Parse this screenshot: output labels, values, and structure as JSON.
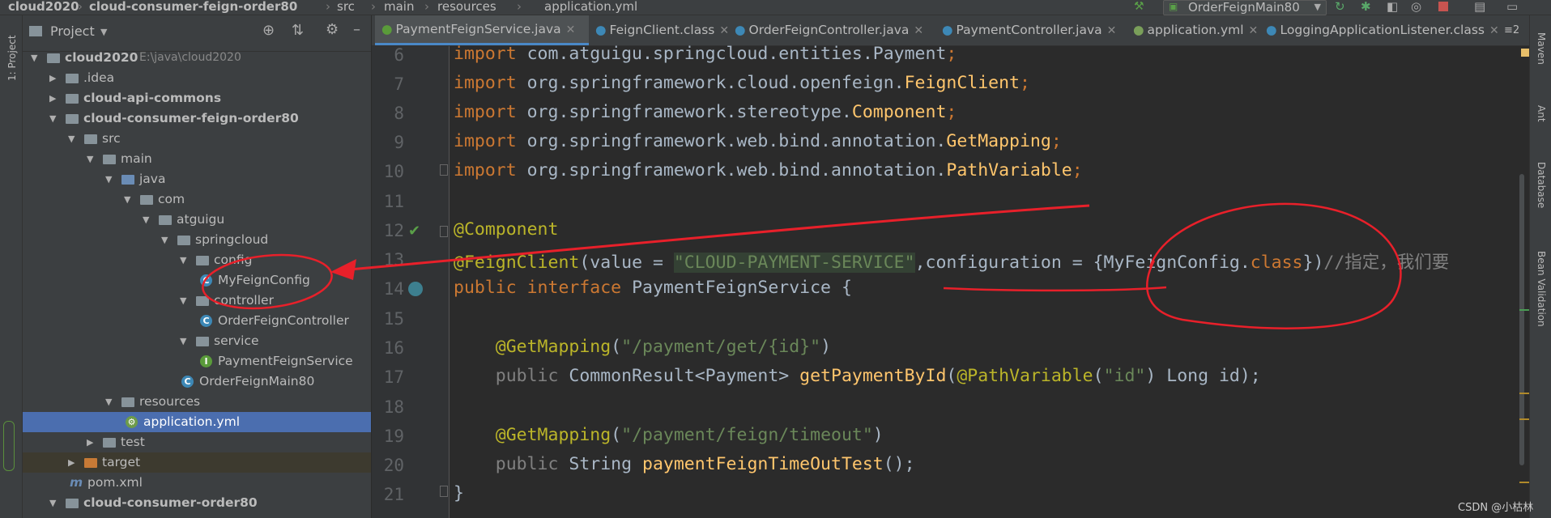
{
  "breadcrumb": [
    "cloud2020",
    "cloud-consumer-feign-order80",
    "src",
    "main",
    "resources",
    "application.yml"
  ],
  "run_config": "OrderFeignMain80",
  "left_strip_label": "1: Project",
  "right_strip_labels": [
    "Maven",
    "Ant",
    "Database",
    "Bean Validation"
  ],
  "project_panel": {
    "title": "Project",
    "tree": [
      {
        "depth": 0,
        "label": "cloud2020",
        "suffix": "E:\\java\\cloud2020",
        "icon": "folder",
        "open": true,
        "bold": true
      },
      {
        "depth": 1,
        "label": ".idea",
        "icon": "folder",
        "open": false
      },
      {
        "depth": 1,
        "label": "cloud-api-commons",
        "icon": "module",
        "open": false,
        "bold": true
      },
      {
        "depth": 1,
        "label": "cloud-consumer-feign-order80",
        "icon": "module",
        "open": true,
        "bold": true
      },
      {
        "depth": 2,
        "label": "src",
        "icon": "folder",
        "open": true
      },
      {
        "depth": 3,
        "label": "main",
        "icon": "folder",
        "open": true
      },
      {
        "depth": 4,
        "label": "java",
        "icon": "folder-blue",
        "open": true
      },
      {
        "depth": 5,
        "label": "com",
        "icon": "package",
        "open": true
      },
      {
        "depth": 6,
        "label": "atguigu",
        "icon": "package",
        "open": true
      },
      {
        "depth": 7,
        "label": "springcloud",
        "icon": "package",
        "open": true
      },
      {
        "depth": 8,
        "label": "config",
        "icon": "package",
        "open": true
      },
      {
        "depth": 9,
        "label": "MyFeignConfig",
        "icon": "class"
      },
      {
        "depth": 8,
        "label": "controller",
        "icon": "package",
        "open": true
      },
      {
        "depth": 9,
        "label": "OrderFeignController",
        "icon": "class"
      },
      {
        "depth": 8,
        "label": "service",
        "icon": "package",
        "open": true
      },
      {
        "depth": 9,
        "label": "PaymentFeignService",
        "icon": "interface"
      },
      {
        "depth": 8,
        "label": "OrderFeignMain80",
        "icon": "class-run"
      },
      {
        "depth": 4,
        "label": "resources",
        "icon": "folder-res",
        "open": true
      },
      {
        "depth": 5,
        "label": "application.yml",
        "icon": "yml",
        "selected": true
      },
      {
        "depth": 3,
        "label": "test",
        "icon": "folder",
        "open": false
      },
      {
        "depth": 2,
        "label": "target",
        "icon": "folder-orange",
        "open": false
      },
      {
        "depth": 2,
        "label": "pom.xml",
        "icon": "maven"
      },
      {
        "depth": 1,
        "label": "cloud-consumer-order80",
        "icon": "module",
        "open": true,
        "bold": true
      }
    ]
  },
  "tabs": [
    {
      "label": "PaymentFeignService.java",
      "active": true
    },
    {
      "label": "FeignClient.class"
    },
    {
      "label": "OrderFeignController.java"
    },
    {
      "label": "PaymentController.java"
    },
    {
      "label": "application.yml"
    },
    {
      "label": "LoggingApplicationListener.class"
    },
    {
      "label": "≡2"
    }
  ],
  "code": {
    "line_numbers": [
      "6",
      "7",
      "8",
      "9",
      "10",
      "11",
      "12",
      "13",
      "14",
      "15",
      "16",
      "17",
      "18",
      "19",
      "20",
      "21"
    ],
    "l6a": "import ",
    "l6b": "com.atguigu.springcloud.entities.",
    "l6c": "Payment",
    "l6d": ";",
    "l7a": "import ",
    "l7b": "org.springframework.cloud.openfeign.",
    "l7c": "FeignClient",
    "l7d": ";",
    "l8a": "import ",
    "l8b": "org.springframework.stereotype.",
    "l8c": "Component",
    "l8d": ";",
    "l9a": "import ",
    "l9b": "org.springframework.web.bind.annotation.",
    "l9c": "GetMapping",
    "l9d": ";",
    "l10a": "import ",
    "l10b": "org.springframework.web.bind.annotation.",
    "l10c": "PathVariable",
    "l10d": ";",
    "l12": "@Component",
    "l13a": "@FeignClient",
    "l13b": "(value = ",
    "l13c": "\"CLOUD-PAYMENT-SERVICE\"",
    "l13d": ",configuration = {MyFeignConfig.",
    "l13e": "class",
    "l13f": "})",
    "l13g": "//指定，我们要",
    "l14a": "public interface ",
    "l14b": "PaymentFeignService {",
    "l16a": "    @GetMapping",
    "l16b": "(",
    "l16c": "\"/payment/get/{id}\"",
    "l16d": ")",
    "l17a": "    public ",
    "l17b": "CommonResult<Payment> ",
    "l17c": "getPaymentById",
    "l17d": "(",
    "l17e": "@PathVariable",
    "l17f": "(",
    "l17g": "\"id\"",
    "l17h": ") Long id);",
    "l19a": "    @GetMapping",
    "l19b": "(",
    "l19c": "\"/payment/feign/timeout\"",
    "l19d": ")",
    "l20a": "    public ",
    "l20b": "String ",
    "l20c": "paymentFeignTimeOutTest",
    "l20d": "();",
    "l21": "}"
  },
  "watermark": "CSDN @小枯林",
  "colors": {
    "annotation_red": "#e8202a",
    "accent": "#4a88c7"
  }
}
